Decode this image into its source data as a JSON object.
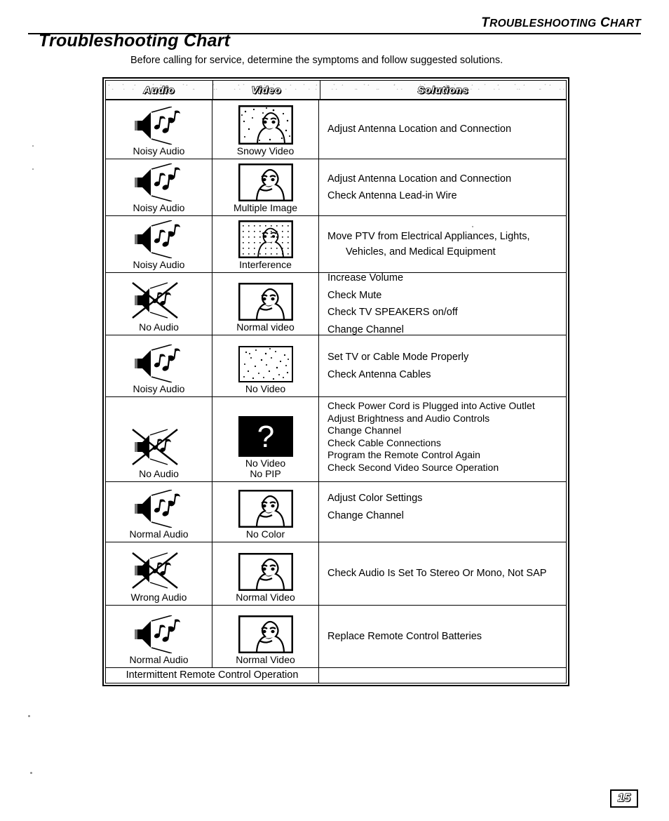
{
  "running_header": {
    "text_main": "T",
    "text": "TROUBLESHOOTING CHART",
    "word1_cap": "T",
    "word1_rest": "ROUBLESHOOTING",
    "word2_cap": "C",
    "word2_rest": "HART"
  },
  "page_title": "Troubleshooting Chart",
  "subtitle": "Before calling for service, determine the symptoms and follow suggested solutions.",
  "table": {
    "columns": [
      {
        "key": "audio",
        "label": "Audio"
      },
      {
        "key": "video",
        "label": "Video"
      },
      {
        "key": "solutions",
        "label": "Solutions"
      }
    ],
    "rows": [
      {
        "audio_icon": "speaker-with-notes",
        "audio_label": "Noisy Audio",
        "video_icon": "tv-snowy",
        "video_label": "Snowy Video",
        "solutions": [
          "Adjust Antenna Location and Connection"
        ]
      },
      {
        "audio_icon": "speaker-with-notes",
        "audio_label": "Noisy Audio",
        "video_icon": "tv-normal",
        "video_label": "Multiple Image",
        "solutions": [
          "Adjust Antenna Location and Connection",
          "Check Antenna Lead-in Wire"
        ]
      },
      {
        "audio_icon": "speaker-with-notes",
        "audio_label": "Noisy Audio",
        "video_icon": "tv-interference",
        "video_label": "Interference",
        "solutions": [
          "Move PTV from Electrical Appliances, Lights,",
          "Vehicles, and Medical Equipment"
        ]
      },
      {
        "audio_icon": "speaker-crossed-out",
        "audio_label": "No Audio",
        "video_icon": "tv-normal",
        "video_label": "Normal video",
        "solutions": [
          "Increase Volume",
          "Check Mute",
          "Check TV SPEAKERS on/off",
          "Change Channel"
        ]
      },
      {
        "audio_icon": "speaker-with-notes",
        "audio_label": "Noisy Audio",
        "video_icon": "tv-blank-dots",
        "video_label": "No Video",
        "solutions": [
          "Set TV or Cable Mode Properly",
          "Check Antenna Cables"
        ]
      },
      {
        "audio_icon": "speaker-crossed-out",
        "audio_label": "No Audio",
        "video_icon": "tv-question-mark",
        "video_label_1": "No Video",
        "video_label_2": "No PIP",
        "solutions": [
          "Check Power Cord is Plugged into Active Outlet",
          "Adjust Brightness and Audio Controls",
          "Change Channel",
          "Check Cable Connections",
          "Program the Remote Control Again",
          "Check Second Video Source Operation"
        ]
      },
      {
        "audio_icon": "speaker-with-notes",
        "audio_label": "Normal Audio",
        "video_icon": "tv-normal",
        "video_label": "No Color",
        "solutions": [
          "Adjust Color Settings",
          "Change Channel"
        ]
      },
      {
        "audio_icon": "speaker-crossed-out",
        "audio_label": "Wrong Audio",
        "video_icon": "tv-normal",
        "video_label": "Normal Video",
        "solutions": [
          "Check Audio Is Set To Stereo Or Mono, Not SAP"
        ]
      },
      {
        "audio_icon": "speaker-with-notes",
        "audio_label": "Normal Audio",
        "video_icon": "tv-normal",
        "video_label": "Normal Video",
        "solutions": [
          "Replace Remote Control Batteries"
        ],
        "footer_span_label": "Intermittent Remote Control Operation"
      }
    ]
  },
  "page_number": "15",
  "colors": {
    "ink": "#000000",
    "paper": "#ffffff",
    "header_fill": "#fcfcfc",
    "screen_black": "#000000"
  }
}
